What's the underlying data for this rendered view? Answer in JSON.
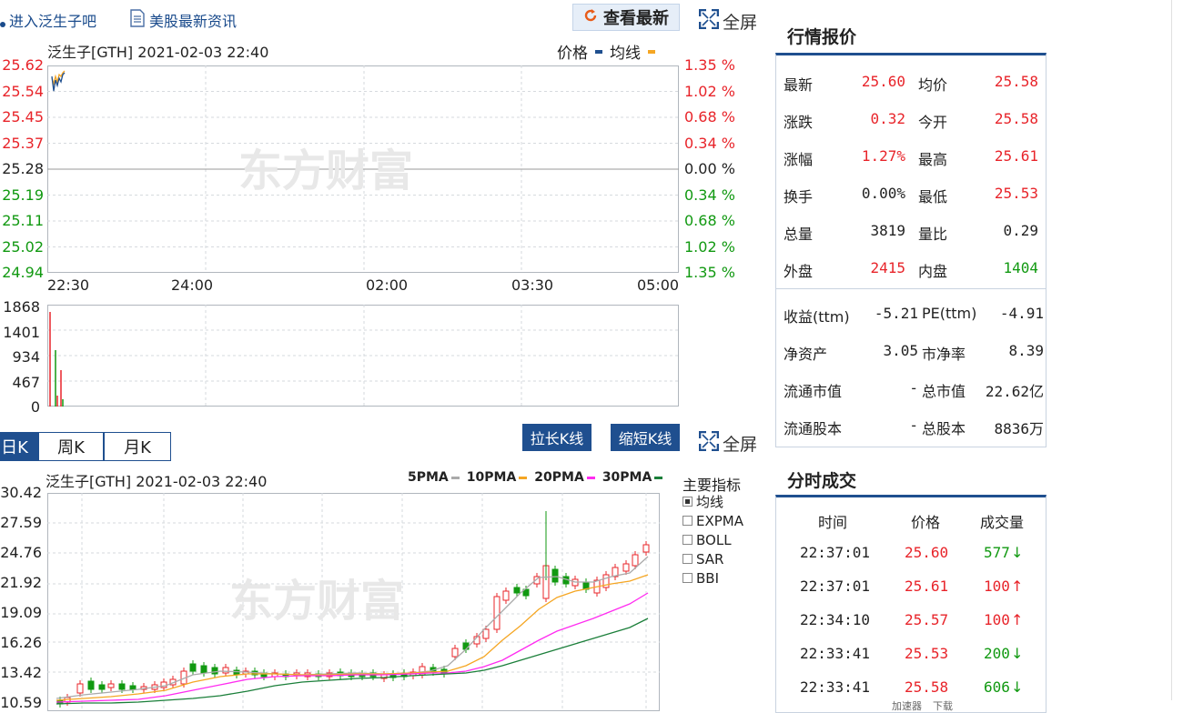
{
  "top": {
    "bar_link": "进入泛生子吧",
    "news_link": "美股最新资讯",
    "latest_button": "查看最新",
    "fullscreen": "全屏"
  },
  "intraday": {
    "header": "泛生子[GTH] 2021-02-03 22:40",
    "legend_price": "价格",
    "legend_avg": "均线",
    "price_ticks": [
      {
        "price": "25.62",
        "pct": "1.35 %",
        "color": "red"
      },
      {
        "price": "25.54",
        "pct": "1.02 %",
        "color": "red"
      },
      {
        "price": "25.45",
        "pct": "0.68 %",
        "color": "red"
      },
      {
        "price": "25.37",
        "pct": "0.34 %",
        "color": "red"
      },
      {
        "price": "25.28",
        "pct": "0.00 %",
        "color": "dark"
      },
      {
        "price": "25.19",
        "pct": "0.34 %",
        "color": "green"
      },
      {
        "price": "25.11",
        "pct": "0.68 %",
        "color": "green"
      },
      {
        "price": "25.02",
        "pct": "1.02 %",
        "color": "green"
      },
      {
        "price": "24.94",
        "pct": "1.35 %",
        "color": "green"
      }
    ],
    "time_ticks": [
      "22:30",
      "24:00",
      "02:00",
      "03:30",
      "05:00"
    ],
    "volume_ticks": [
      "1868",
      "1401",
      "934",
      "467",
      "0"
    ],
    "watermark": "东方财富"
  },
  "kline": {
    "tabs": [
      "日K",
      "周K",
      "月K"
    ],
    "lengthen": "拉长K线",
    "shorten": "缩短K线",
    "fullscreen": "全屏",
    "header": "泛生子[GTH] 2021-02-03 22:40",
    "ma_legend": [
      {
        "label": "5PMA",
        "color": "#aaaaaa"
      },
      {
        "label": "10PMA",
        "color": "#f5a623"
      },
      {
        "label": "20PMA",
        "color": "#ff2cf0"
      },
      {
        "label": "30PMA",
        "color": "#1b7f3a"
      }
    ],
    "y_ticks": [
      "30.42",
      "27.59",
      "24.76",
      "21.92",
      "19.09",
      "16.26",
      "13.42",
      "10.59"
    ],
    "indicator_title": "主要指标",
    "indicators": [
      {
        "label": "均线",
        "checked": true
      },
      {
        "label": "EXPMA",
        "checked": false
      },
      {
        "label": "BOLL",
        "checked": false
      },
      {
        "label": "SAR",
        "checked": false
      },
      {
        "label": "BBI",
        "checked": false
      }
    ],
    "watermark": "东方财富"
  },
  "quote": {
    "title": "行情报价",
    "rows": [
      {
        "l1": "最新",
        "v1": "25.60",
        "c1": "red",
        "l2": "均价",
        "v2": "25.58",
        "c2": "red"
      },
      {
        "l1": "涨跌",
        "v1": "0.32",
        "c1": "red",
        "l2": "今开",
        "v2": "25.58",
        "c2": "red"
      },
      {
        "l1": "涨幅",
        "v1": "1.27%",
        "c1": "red",
        "l2": "最高",
        "v2": "25.61",
        "c2": "red"
      },
      {
        "l1": "换手",
        "v1": "0.00%",
        "c1": "dark",
        "l2": "最低",
        "v2": "25.53",
        "c2": "red"
      },
      {
        "l1": "总量",
        "v1": "3819",
        "c1": "dark",
        "l2": "量比",
        "v2": "0.29",
        "c2": "dark"
      },
      {
        "l1": "外盘",
        "v1": "2415",
        "c1": "red",
        "l2": "内盘",
        "v2": "1404",
        "c2": "green"
      }
    ],
    "rows2": [
      {
        "l1": "收益(ttm)",
        "v1": "-5.21",
        "l2": "PE(ttm)",
        "v2": "-4.91"
      },
      {
        "l1": "净资产",
        "v1": "3.05",
        "l2": "市净率",
        "v2": "8.39"
      },
      {
        "l1": "流通市值",
        "v1": "-",
        "l2": "总市值",
        "v2": "22.62亿"
      },
      {
        "l1": "流通股本",
        "v1": "-",
        "l2": "总股本",
        "v2": "8836万"
      }
    ]
  },
  "trades": {
    "title": "分时成交",
    "headers": [
      "时间",
      "价格",
      "成交量"
    ],
    "rows": [
      {
        "time": "22:37:01",
        "price": "25.60",
        "vol": "577",
        "dir": "↓"
      },
      {
        "time": "22:37:01",
        "price": "25.61",
        "vol": "100",
        "dir": "↑"
      },
      {
        "time": "22:34:10",
        "price": "25.57",
        "vol": "100",
        "dir": "↑"
      },
      {
        "time": "22:33:41",
        "price": "25.53",
        "vol": "200",
        "dir": "↓"
      },
      {
        "time": "22:33:41",
        "price": "25.58",
        "vol": "606",
        "dir": "↓"
      }
    ]
  },
  "status": {
    "items": [
      "加速器",
      "下载"
    ]
  }
}
